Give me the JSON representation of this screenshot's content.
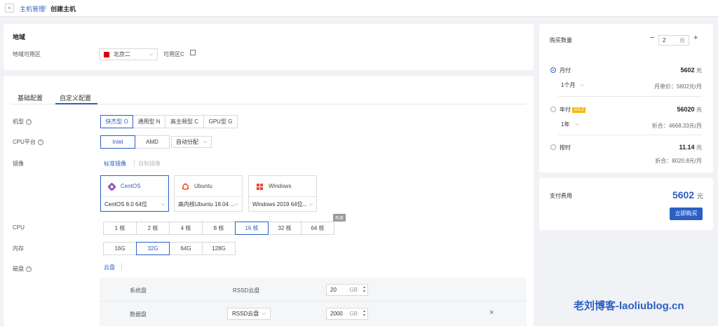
{
  "breadcrumb": {
    "back": "<",
    "parent": "主机管理",
    "sep": "/",
    "current": "创建主机"
  },
  "region": {
    "title": "地域",
    "label": "地域可用区",
    "city": "北京二",
    "zone": "可用区C"
  },
  "tabs": [
    "基础配置",
    "自定义配置"
  ],
  "machine_type": {
    "label": "机型",
    "options": [
      "快杰型 O",
      "通用型 N",
      "高主频型 C",
      "GPU型 G"
    ],
    "active": 0
  },
  "cpu_platform": {
    "label": "CPU平台",
    "options": [
      "Intel",
      "AMD"
    ],
    "active": 0,
    "auto": "自动分配"
  },
  "image": {
    "label": "镜像",
    "subtabs": [
      "标准镜像",
      "自制镜像"
    ],
    "cards": [
      {
        "name": "CentOS",
        "version": "CentOS 8.0 64位"
      },
      {
        "name": "Ubuntu",
        "version": "高内核Ubuntu 18.04 ..."
      },
      {
        "name": "Windows",
        "version": "Windows 2019 64位..."
      }
    ]
  },
  "cpu": {
    "label": "CPU",
    "options": [
      "1 核",
      "2 核",
      "4 核",
      "8 核",
      "16 核",
      "32 核",
      "64 核"
    ],
    "active": 4,
    "badge": "热卖"
  },
  "memory": {
    "label": "内存",
    "options": [
      "16G",
      "32G",
      "64G",
      "128G"
    ],
    "active": 1
  },
  "disk": {
    "label": "磁盘",
    "tab": "云盘",
    "system": {
      "name": "系统盘",
      "type": "RSSD云盘",
      "size": "20",
      "unit": "GB"
    },
    "data": {
      "name": "数据盘",
      "type": "RSSD云盘",
      "size": "2000",
      "unit": "GB",
      "remove": "×"
    }
  },
  "purchase": {
    "qty_label": "购买数量",
    "qty": "2",
    "qty_unit": "台",
    "minus": "−",
    "plus": "+",
    "monthly": {
      "label": "月付",
      "price": "5602",
      "yuan": "元",
      "period": "1个月",
      "unit_price": "月单价：5602元/月"
    },
    "yearly": {
      "label": "年付",
      "sale": "SALE",
      "price": "56020",
      "yuan": "元",
      "period": "1年",
      "note": "折合：4668.33元/月"
    },
    "hourly": {
      "label": "按时",
      "price": "11.14",
      "yuan": "元",
      "note": "折合：8020.8元/月"
    }
  },
  "payment": {
    "label": "支付费用",
    "price": "5602",
    "yuan": "元",
    "buy": "立即购买"
  },
  "watermark": "老刘博客-laoliublog.cn",
  "colors": {
    "accent": "#2b5fc4",
    "sale": "#f5b800",
    "flag": "#dd0000"
  }
}
